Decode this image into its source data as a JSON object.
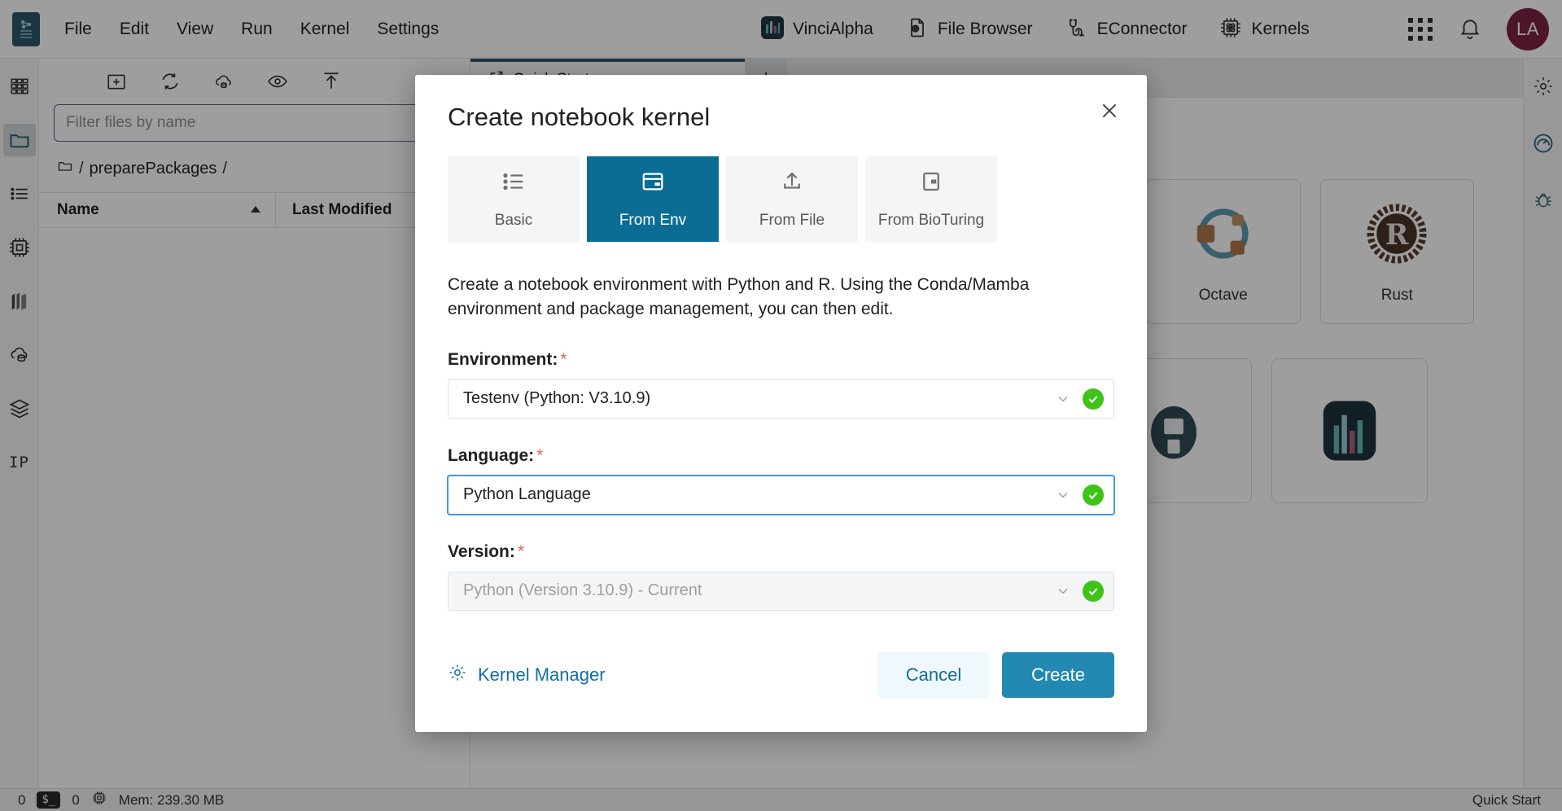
{
  "menubar": {
    "logo_icon": "notebook-logo-icon",
    "items": [
      {
        "label": "File"
      },
      {
        "label": "Edit"
      },
      {
        "label": "View"
      },
      {
        "label": "Run"
      },
      {
        "label": "Kernel"
      },
      {
        "label": "Settings"
      }
    ],
    "center_links": [
      {
        "label": "VinciAlpha",
        "icon": "vincialpha-icon"
      },
      {
        "label": "File Browser",
        "icon": "file-browser-icon"
      },
      {
        "label": "EConnector",
        "icon": "econnector-plug-icon"
      },
      {
        "label": "Kernels",
        "icon": "kernels-chip-icon"
      }
    ],
    "right": {
      "apps_icon": "apps-grid-icon",
      "notifications_icon": "bell-icon",
      "avatar_initials": "LA"
    }
  },
  "left_rail": {
    "items": [
      {
        "icon": "grid-icon",
        "name": "launcher"
      },
      {
        "icon": "folder-icon",
        "name": "file-browser",
        "active": true
      },
      {
        "icon": "list-icon",
        "name": "running-list"
      },
      {
        "icon": "chip-icon",
        "name": "kernels"
      },
      {
        "icon": "blocks-icon",
        "name": "packages"
      },
      {
        "icon": "cloud-database-icon",
        "name": "cloud-storage"
      },
      {
        "icon": "layers-icon",
        "name": "layers"
      },
      {
        "label": "IP",
        "icon": "ip-text-icon",
        "name": "ip"
      }
    ]
  },
  "right_rail": {
    "items": [
      {
        "icon": "settings-gear-icon",
        "name": "settings"
      },
      {
        "icon": "dashboard-gauge-icon",
        "name": "dashboard",
        "active": true
      },
      {
        "icon": "bug-icon",
        "name": "debugger"
      }
    ]
  },
  "file_browser": {
    "toolbar": [
      {
        "icon": "new-folder-icon",
        "name": "new-folder"
      },
      {
        "icon": "refresh-icon",
        "name": "refresh"
      },
      {
        "icon": "cloud-upload-icon",
        "name": "cloud-sync"
      },
      {
        "icon": "eye-icon",
        "name": "toggle-hidden"
      },
      {
        "icon": "upload-icon",
        "name": "upload"
      }
    ],
    "search": {
      "value": "",
      "placeholder": "Filter files by name",
      "icon": "search-icon"
    },
    "breadcrumb": {
      "root_icon": "folder-small-icon",
      "sep1": "/",
      "folder": "preparePackages",
      "sep2": "/",
      "star_icon": "star-icon"
    },
    "columns": [
      {
        "label": "Name",
        "sort": "asc",
        "sort_icon": "caret-up-icon"
      },
      {
        "label": "Last Modified"
      }
    ],
    "rows": []
  },
  "main": {
    "tab": {
      "label": "Quick Start",
      "icon": "quick-start-icon"
    },
    "add_tab_label": "+",
    "cards_row1": [
      {
        "label": "Octave",
        "icon": "octave-icon"
      },
      {
        "label": "Rust",
        "icon": "rust-icon"
      }
    ],
    "cards_row2": [
      {
        "label": "",
        "icon": "vscode-icon"
      },
      {
        "label": "",
        "icon": "rstudio-icon"
      },
      {
        "label": "",
        "icon": "shiny-icon"
      },
      {
        "label": "",
        "icon": "jupyter-book-icon"
      },
      {
        "label": "",
        "icon": "vincialpha-icon"
      }
    ]
  },
  "statusbar": {
    "kernel_count": "0",
    "terminal_icon": "terminal-icon",
    "terminal_count": "0",
    "cpu_icon": "chip-icon",
    "memory": "Mem: 239.30 MB",
    "right_label": "Quick Start"
  },
  "modal": {
    "title": "Create notebook kernel",
    "close_icon": "close-icon",
    "tabs": [
      {
        "label": "Basic",
        "icon": "list-icon",
        "active": false
      },
      {
        "label": "From Env",
        "icon": "window-card-icon",
        "active": true
      },
      {
        "label": "From File",
        "icon": "upload-icon",
        "active": false
      },
      {
        "label": "From BioTuring",
        "icon": "bioturing-icon",
        "active": false
      }
    ],
    "description": "Create a notebook environment with Python and R. Using the Conda/Mamba environment and package management, you can then edit.",
    "fields": [
      {
        "label": "Environment:",
        "required": "*",
        "value": "Testenv (Python: V3.10.9)",
        "state": "normal",
        "chevron_icon": "chevron-down-icon",
        "valid_icon": "check-circle-icon"
      },
      {
        "label": "Language:",
        "required": "*",
        "value": "Python Language",
        "state": "focused",
        "chevron_icon": "chevron-down-icon",
        "valid_icon": "check-circle-icon"
      },
      {
        "label": "Version:",
        "required": "*",
        "value": "Python (Version 3.10.9) - Current",
        "state": "disabled",
        "chevron_icon": "chevron-down-icon",
        "valid_icon": "check-circle-icon"
      }
    ],
    "footer": {
      "kernel_manager_label": "Kernel Manager",
      "kernel_manager_icon": "gear-icon",
      "cancel_label": "Cancel",
      "create_label": "Create"
    }
  },
  "colors": {
    "accent_teal": "#0b6d94",
    "create_button": "#2389b2",
    "cancel_button_bg": "#eff8fd",
    "link_blue": "#1170a0",
    "valid_green": "#3fc319",
    "required_red": "#e8635f",
    "avatar_magenta": "#b4114b",
    "focus_blue": "#3f97e0"
  }
}
